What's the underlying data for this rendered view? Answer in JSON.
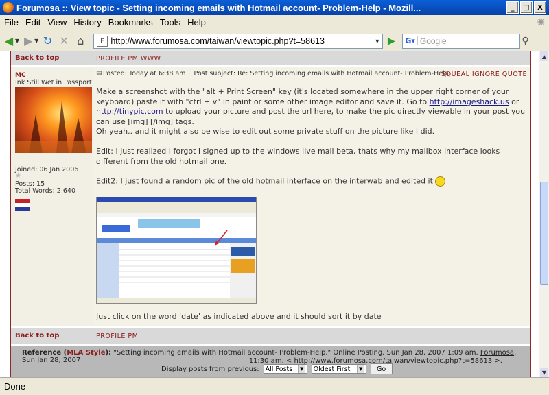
{
  "window": {
    "title": "Forumosa :: View topic - Setting incoming emails with Hotmail account- Problem-Help - Mozill...",
    "min": "_",
    "max": "□",
    "close": "X"
  },
  "menu": [
    "File",
    "Edit",
    "View",
    "History",
    "Bookmarks",
    "Tools",
    "Help"
  ],
  "nav": {
    "url": "http://www.forumosa.com/taiwan/viewtopic.php?t=58613",
    "search_placeholder": "Google",
    "favicon": "F"
  },
  "top_row": {
    "back_to_top": "Back to top",
    "links": "PROFILE PM WWW"
  },
  "post": {
    "username": "MC",
    "user_title": "Ink Still Wet in Passport",
    "joined": "Joined: 06 Jan 2006",
    "posts": "Posts: 15",
    "total_words": "Total Words: 2,640",
    "header": "Posted: Today at 6:38 am    Post subject: Re: Setting incoming emails with Hotmail account- Problem-Help",
    "actions": "SQUEAL IGNORE QUOTE",
    "p1_a": "Make a screenshot with the \"alt + Print Screen\" key (it's located somewhere in the upper right corner of your keyboard) paste it with \"ctrl + v\" in paint or some other image editor and save it. Go to ",
    "link1": "http://imageshack.us",
    "p1_or": " or ",
    "link2": "http://tinypic.com",
    "p1_b": " to upload your picture and post the url here, to make the pic directly viewable in your post you can use [img] [/img] tags.",
    "p2": "Oh yeah.. and it might also be wise to edit out some private stuff on the picture like I did.",
    "p3": "Edit: I just realized I forgot I signed up to the windows live mail beta, thats why my mailbox interface looks different from the old hotmail one.",
    "p4": "Edit2: I just found a random pic of the old hotmail interface on the interwab and edited it",
    "p5": "Just click on the word 'date' as indicated above and it should sort it by date"
  },
  "bottom_row": {
    "back_to_top": "Back to top",
    "links": "PROFILE PM"
  },
  "reference": {
    "label": "Reference (",
    "mla": "MLA Style",
    "label_end": "):",
    "text": " \"Setting incoming emails with Hotmail account- Problem-Help.\" Online Posting. Sun Jan 28, 2007 1:09 am. ",
    "forumosa": "Forumosa",
    "text2": ". Sun Jan 28, 2007",
    "line2": "11:30 am. < http://www.forumosa.com/taiwan/viewtopic.php?t=58613 >.",
    "display_label": "Display posts from previous:",
    "select1": "All Posts",
    "select2": "Oldest First",
    "go": "Go"
  },
  "status": "Done"
}
